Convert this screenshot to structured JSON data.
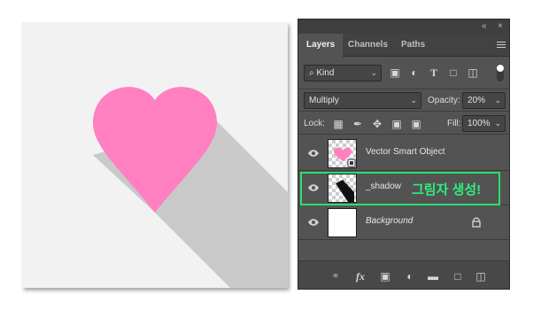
{
  "canvas": {
    "background": "#f2f2f2",
    "heart_color": "#ff7fc1",
    "shadow_color": "#c9c9c9"
  },
  "panel": {
    "window_controls": {
      "collapse": "«",
      "close": "×"
    },
    "tabs": [
      {
        "label": "Layers",
        "active": true
      },
      {
        "label": "Channels",
        "active": false
      },
      {
        "label": "Paths",
        "active": false
      }
    ],
    "filter": {
      "kind_label": "Kind",
      "filter_icons": [
        "image-filter-icon",
        "adjustment-filter-icon",
        "type-filter-icon",
        "shape-filter-icon",
        "smart-object-filter-icon"
      ]
    },
    "blend": {
      "mode": "Multiply",
      "opacity_label": "Opacity:",
      "opacity_value": "20%"
    },
    "lock": {
      "label": "Lock:",
      "fill_label": "Fill:",
      "fill_value": "100%"
    },
    "layers": [
      {
        "name": "Vector Smart Object",
        "visible": true,
        "selected": false,
        "thumb": "heart"
      },
      {
        "name": "_shadow",
        "visible": true,
        "selected": true,
        "thumb": "shadow",
        "annotation": "그림자 생성!"
      },
      {
        "name": "Background",
        "visible": true,
        "selected": false,
        "thumb": "white",
        "locked": true
      }
    ],
    "bottom_icons": [
      "link-layers-icon",
      "fx-icon",
      "mask-icon",
      "adjustment-layer-icon",
      "group-folder-icon",
      "new-layer-icon",
      "trash-icon"
    ],
    "fx_label": "fx",
    "accent_color": "#28e070"
  }
}
